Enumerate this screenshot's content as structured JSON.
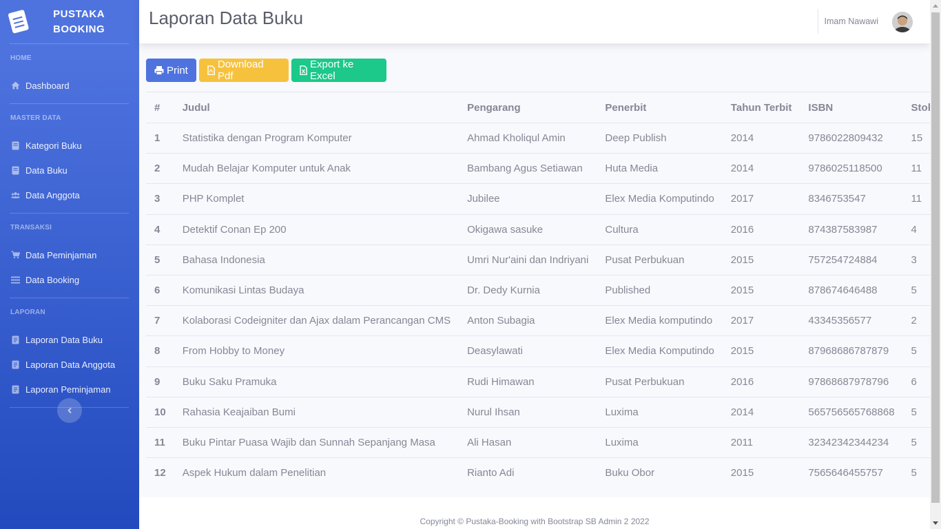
{
  "brand": {
    "line1": "PUSTAKA",
    "line2": "BOOKING"
  },
  "sidebar": {
    "sections": [
      {
        "heading": "HOME",
        "items": [
          {
            "label": "Dashboard",
            "icon": "home-icon"
          }
        ]
      },
      {
        "heading": "MASTER DATA",
        "items": [
          {
            "label": "Kategori Buku",
            "icon": "book-icon"
          },
          {
            "label": "Data Buku",
            "icon": "book-icon"
          },
          {
            "label": "Data Anggota",
            "icon": "users-icon"
          }
        ]
      },
      {
        "heading": "TRANSAKSI",
        "items": [
          {
            "label": "Data Peminjaman",
            "icon": "cart-icon"
          },
          {
            "label": "Data Booking",
            "icon": "list-icon"
          }
        ]
      },
      {
        "heading": "LAPORAN",
        "items": [
          {
            "label": "Laporan Data Buku",
            "icon": "report-book-icon"
          },
          {
            "label": "Laporan Data Anggota",
            "icon": "report-book-icon"
          },
          {
            "label": "Laporan Peminjaman",
            "icon": "report-book-icon"
          }
        ]
      }
    ]
  },
  "topbar": {
    "title": "Laporan Data Buku",
    "user_name": "Imam Nawawi"
  },
  "actions": {
    "print": "Print",
    "pdf": "Download Pdf",
    "excel": "Export ke Excel"
  },
  "table": {
    "headers": [
      "#",
      "Judul",
      "Pengarang",
      "Penerbit",
      "Tahun Terbit",
      "ISBN",
      "Stok"
    ],
    "rows": [
      [
        "1",
        "Statistika dengan Program Komputer",
        "Ahmad Kholiqul Amin",
        "Deep Publish",
        "2014",
        "9786022809432",
        "15"
      ],
      [
        "2",
        "Mudah Belajar Komputer untuk Anak",
        "Bambang Agus Setiawan",
        "Huta Media",
        "2014",
        "9786025118500",
        "11"
      ],
      [
        "3",
        "PHP Komplet",
        "Jubilee",
        "Elex Media Komputindo",
        "2017",
        "8346753547",
        "11"
      ],
      [
        "4",
        "Detektif Conan Ep 200",
        "Okigawa sasuke",
        "Cultura",
        "2016",
        "874387583987",
        "4"
      ],
      [
        "5",
        "Bahasa Indonesia",
        "Umri Nur'aini dan Indriyani",
        "Pusat Perbukuan",
        "2015",
        "757254724884",
        "3"
      ],
      [
        "6",
        "Komunikasi Lintas Budaya",
        "Dr. Dedy Kurnia",
        "Published",
        "2015",
        "878674646488",
        "5"
      ],
      [
        "7",
        "Kolaborasi Codeigniter dan Ajax dalam Perancangan CMS",
        "Anton Subagia",
        "Elex Media komputindo",
        "2017",
        "43345356577",
        "2"
      ],
      [
        "8",
        "From Hobby to Money",
        "Deasylawati",
        "Elex Media Komputindo",
        "2015",
        "87968686787879",
        "5"
      ],
      [
        "9",
        "Buku Saku Pramuka",
        "Rudi Himawan",
        "Pusat Perbukuan",
        "2016",
        "97868687978796",
        "6"
      ],
      [
        "10",
        "Rahasia Keajaiban Bumi",
        "Nurul Ihsan",
        "Luxima",
        "2014",
        "565756565768868",
        "5"
      ],
      [
        "11",
        "Buku Pintar Puasa Wajib dan Sunnah Sepanjang Masa",
        "Ali Hasan",
        "Luxima",
        "2011",
        "32342342344234",
        "5"
      ],
      [
        "12",
        "Aspek Hukum dalam Penelitian",
        "Rianto Adi",
        "Buku Obor",
        "2015",
        "7565646455757",
        "5"
      ]
    ]
  },
  "footer": {
    "text": "Copyright © Pustaka-Booking with Bootstrap SB Admin 2 2022"
  }
}
